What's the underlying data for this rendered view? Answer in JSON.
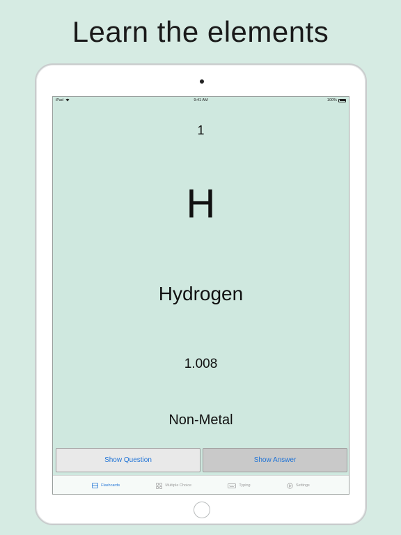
{
  "headline": "Learn the elements",
  "status_bar": {
    "device": "iPad",
    "time": "9:41 AM",
    "battery": "100%"
  },
  "card": {
    "atomic_number": "1",
    "symbol": "H",
    "name": "Hydrogen",
    "atomic_mass": "1.008",
    "category": "Non-Metal"
  },
  "buttons": {
    "show_question": "Show Question",
    "show_answer": "Show Answer"
  },
  "tabs": [
    {
      "label": "Flashcards",
      "icon": "flashcards-icon",
      "active": true
    },
    {
      "label": "Multiple Choice",
      "icon": "grid-icon",
      "active": false
    },
    {
      "label": "Typing",
      "icon": "keyboard-icon",
      "active": false
    },
    {
      "label": "Settings",
      "icon": "play-circle-icon",
      "active": false
    }
  ],
  "colors": {
    "background": "#d6ebe3",
    "screen": "#cfe8df",
    "accent": "#1f73d6",
    "tab_inactive": "#9a9a9a"
  }
}
